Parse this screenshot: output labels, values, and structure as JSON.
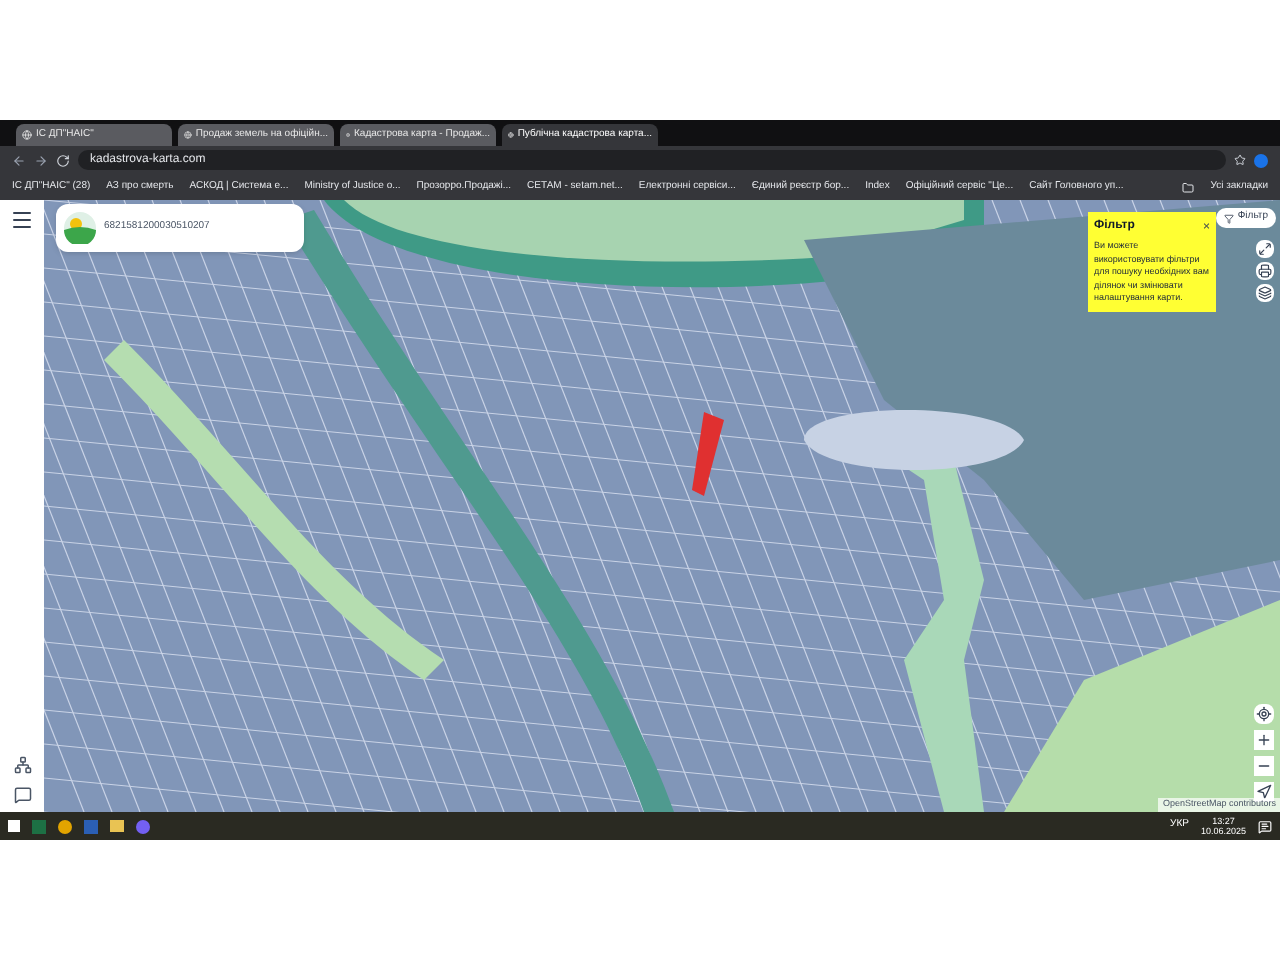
{
  "tabs": [
    {
      "label": "ІС ДП\"НАІС\"",
      "selected": false
    },
    {
      "label": "Продаж земель на офіційн...",
      "selected": false
    },
    {
      "label": "Кадастрова карта - Продаж...",
      "selected": false
    },
    {
      "label": "Публічна кадастрова карта...",
      "selected": true
    }
  ],
  "address": {
    "url": "kadastrova-karta.com"
  },
  "bookmarks": [
    "ІС ДП\"НАІС\" (28)",
    "АЗ про смерть",
    "АСКОД | Система е...",
    "Ministry of Justice o...",
    "Прозорро.Продажі...",
    "СЕТАМ - setam.net...",
    "Електронні сервіси...",
    "Єдиний реєстр бор...",
    "Index",
    "Офіційний сервіс \"Це...",
    "Сайт Головного уп..."
  ],
  "all_bookmarks": "Усі закладки",
  "search": {
    "value": "6821581200030510207"
  },
  "filter_button": "Фільтр",
  "filter_popup": {
    "title": "Фільтр",
    "text": "Ви можете використовувати фільтри для пошуку необхідних вам ділянок чи змінювати налаштування карти.",
    "close": "×"
  },
  "attribution": "OpenStreetMap contributors",
  "taskbar": {
    "language": "УКР",
    "time": "13:27",
    "date": "10.06.2025"
  }
}
